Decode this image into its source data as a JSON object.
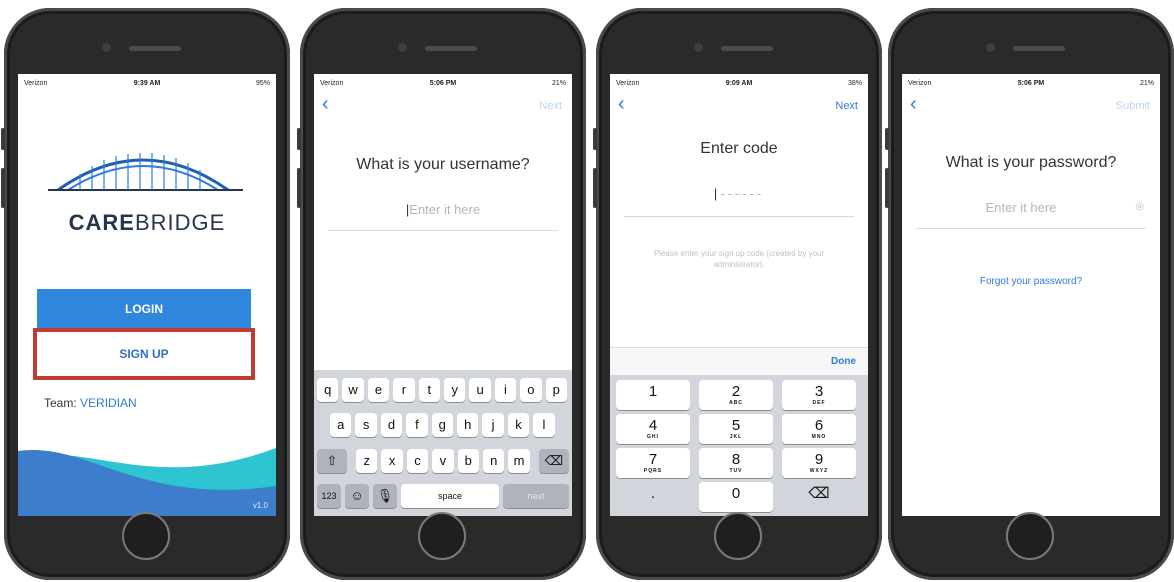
{
  "phones": [
    {
      "status": {
        "carrier": "Verizon",
        "time": "9:39 AM",
        "battery": "95%"
      },
      "brand": {
        "care": "CARE",
        "bridge": "BRIDGE"
      },
      "login_label": "LOGIN",
      "signup_label": "SIGN UP",
      "team_label": "Team:",
      "team_name": "VERIDIAN",
      "version": "v1.0",
      "highlight_color": "#c23a32"
    },
    {
      "status": {
        "carrier": "Verizon",
        "time": "5:06 PM",
        "battery": "21%"
      },
      "back_icon": "chevron-left-icon",
      "next_label": "Next",
      "title": "What is your username?",
      "placeholder": "Enter it here",
      "keyboard": {
        "row1": [
          "q",
          "w",
          "e",
          "r",
          "t",
          "y",
          "u",
          "i",
          "o",
          "p"
        ],
        "row2": [
          "a",
          "s",
          "d",
          "f",
          "g",
          "h",
          "j",
          "k",
          "l"
        ],
        "row3": [
          "z",
          "x",
          "c",
          "v",
          "b",
          "n",
          "m"
        ],
        "numbers_key": "123",
        "space_key": "space",
        "next_key": "next"
      }
    },
    {
      "status": {
        "carrier": "Verizon",
        "time": "9:09 AM",
        "battery": "38%"
      },
      "next_label": "Next",
      "title": "Enter code",
      "code_placeholder": "------",
      "helper": "Please enter your sign up code (created by your administrator).",
      "done_label": "Done",
      "numpad": [
        {
          "n": "1",
          "l": ""
        },
        {
          "n": "2",
          "l": "ABC"
        },
        {
          "n": "3",
          "l": "DEF"
        },
        {
          "n": "4",
          "l": "GHI"
        },
        {
          "n": "5",
          "l": "JKL"
        },
        {
          "n": "6",
          "l": "MNO"
        },
        {
          "n": "7",
          "l": "PQRS"
        },
        {
          "n": "8",
          "l": "TUV"
        },
        {
          "n": "9",
          "l": "WXYZ"
        },
        {
          "n": ".",
          "l": ""
        },
        {
          "n": "0",
          "l": ""
        },
        {
          "n": "⌫",
          "l": ""
        }
      ]
    },
    {
      "status": {
        "carrier": "Verizon",
        "time": "5:06 PM",
        "battery": "21%"
      },
      "submit_label": "Submit",
      "title": "What is your password?",
      "placeholder": "Enter it here",
      "forgot_label": "Forgot your password?"
    }
  ],
  "colors": {
    "accent": "#2f86dc",
    "link": "#2f7bdc",
    "wave_dark": "#3d7dcc",
    "wave_teal": "#2ec4d0"
  }
}
